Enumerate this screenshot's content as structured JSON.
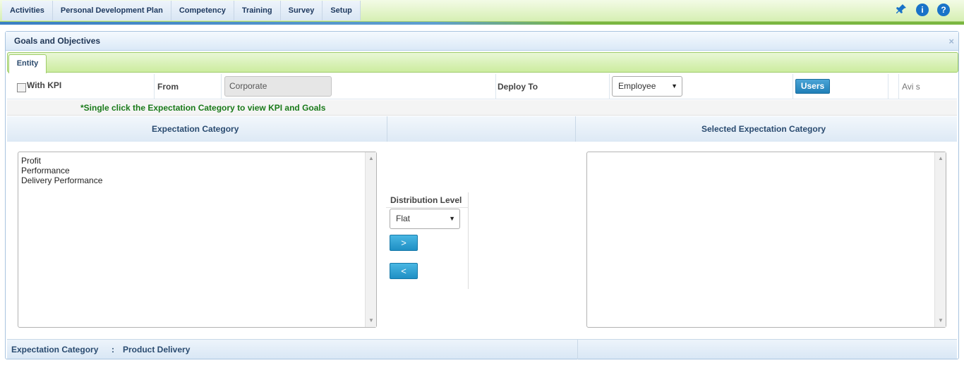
{
  "nav": {
    "tabs": [
      "Activities",
      "Personal Development Plan",
      "Competency",
      "Training",
      "Survey",
      "Setup"
    ],
    "icons": [
      "pin-icon",
      "info-icon",
      "help-icon"
    ],
    "info_glyph": "i",
    "help_glyph": "?"
  },
  "panel": {
    "title": "Goals and Objectives",
    "close_glyph": "×",
    "tab": "Entity"
  },
  "form": {
    "with_kpi_label": "With KPI",
    "from_label": "From",
    "from_value": "Corporate",
    "deploy_to_label": "Deploy To",
    "deploy_to_value": "Employee",
    "users_button": "Users",
    "avi_text": "Avi s"
  },
  "hint": "*Single click the Expectation Category to view KPI and Goals",
  "columns": {
    "left_header": "Expectation Category",
    "right_header": "Selected Expectation Category"
  },
  "expectation_list": [
    "Profit",
    "Performance",
    "Delivery Performance"
  ],
  "selected_list": [],
  "distribution": {
    "label": "Distribution Level",
    "value": "Flat",
    "add_button": ">",
    "remove_button": "<"
  },
  "footer": {
    "label": "Expectation Category",
    "separator": ":",
    "value": "Product Delivery"
  },
  "colors": {
    "accent_blue": "#1a73c8",
    "hint_green": "#1a7a1a",
    "tab_green": "#ccec9f"
  }
}
